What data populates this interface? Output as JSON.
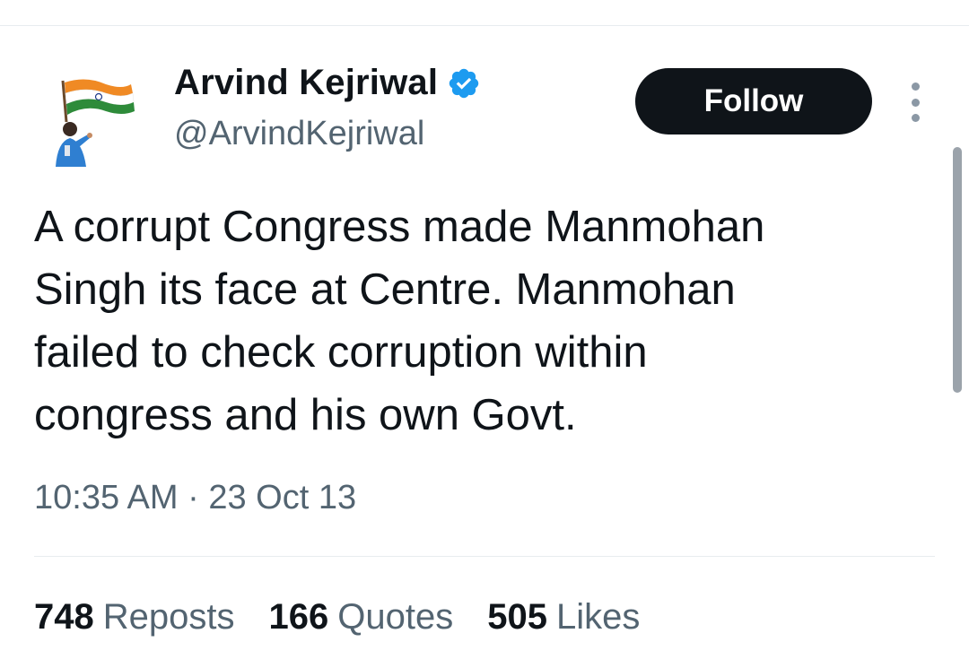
{
  "author": {
    "name": "Arvind Kejriwal",
    "handle": "@ArvindKejriwal",
    "verified": true,
    "verified_color": "#1d9bf0"
  },
  "actions": {
    "follow_label": "Follow"
  },
  "tweet": {
    "text": "A corrupt Congress made Manmohan\nSingh its face at Centre. Manmohan\nfailed to check corruption within\ncongress and his own Govt.",
    "timestamp": "10:35 AM · 23 Oct 13"
  },
  "stats": [
    {
      "count": "748",
      "label": "Reposts"
    },
    {
      "count": "166",
      "label": "Quotes"
    },
    {
      "count": "505",
      "label": "Likes"
    }
  ],
  "icons": {
    "avatar": "avatar-image",
    "verified": "verified-badge-icon",
    "more": "more-options-icon"
  }
}
